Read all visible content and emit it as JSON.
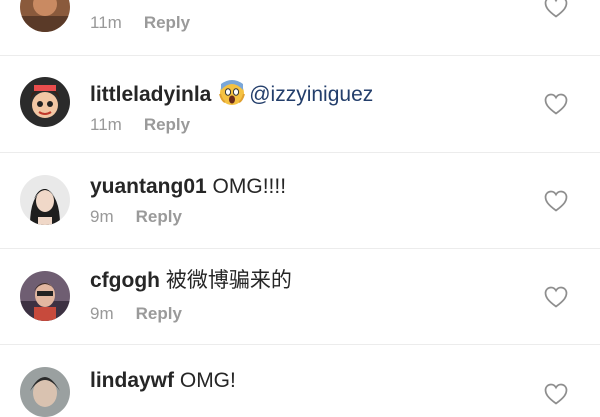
{
  "comments": [
    {
      "username": "",
      "text": "",
      "time": "11m",
      "reply_label": "Reply",
      "avatar_icon": "avatar-photo"
    },
    {
      "username": "littleladyinla",
      "emoji": "scream-emoji",
      "mention": "@izzyiniguez",
      "time": "11m",
      "reply_label": "Reply",
      "avatar_icon": "avatar-cartoon"
    },
    {
      "username": "yuantang01",
      "text": "OMG!!!!",
      "time": "9m",
      "reply_label": "Reply",
      "avatar_icon": "avatar-photo"
    },
    {
      "username": "cfgogh",
      "text": "被微博骗来的",
      "time": "9m",
      "reply_label": "Reply",
      "avatar_icon": "avatar-photo"
    },
    {
      "username": "lindaywf",
      "text": "OMG!",
      "time": "",
      "reply_label": "",
      "avatar_icon": "avatar-photo"
    }
  ],
  "watermark": "",
  "colors": {
    "text": "#262626",
    "meta": "#999999",
    "mention": "#233e6b",
    "divider": "#ececec"
  }
}
